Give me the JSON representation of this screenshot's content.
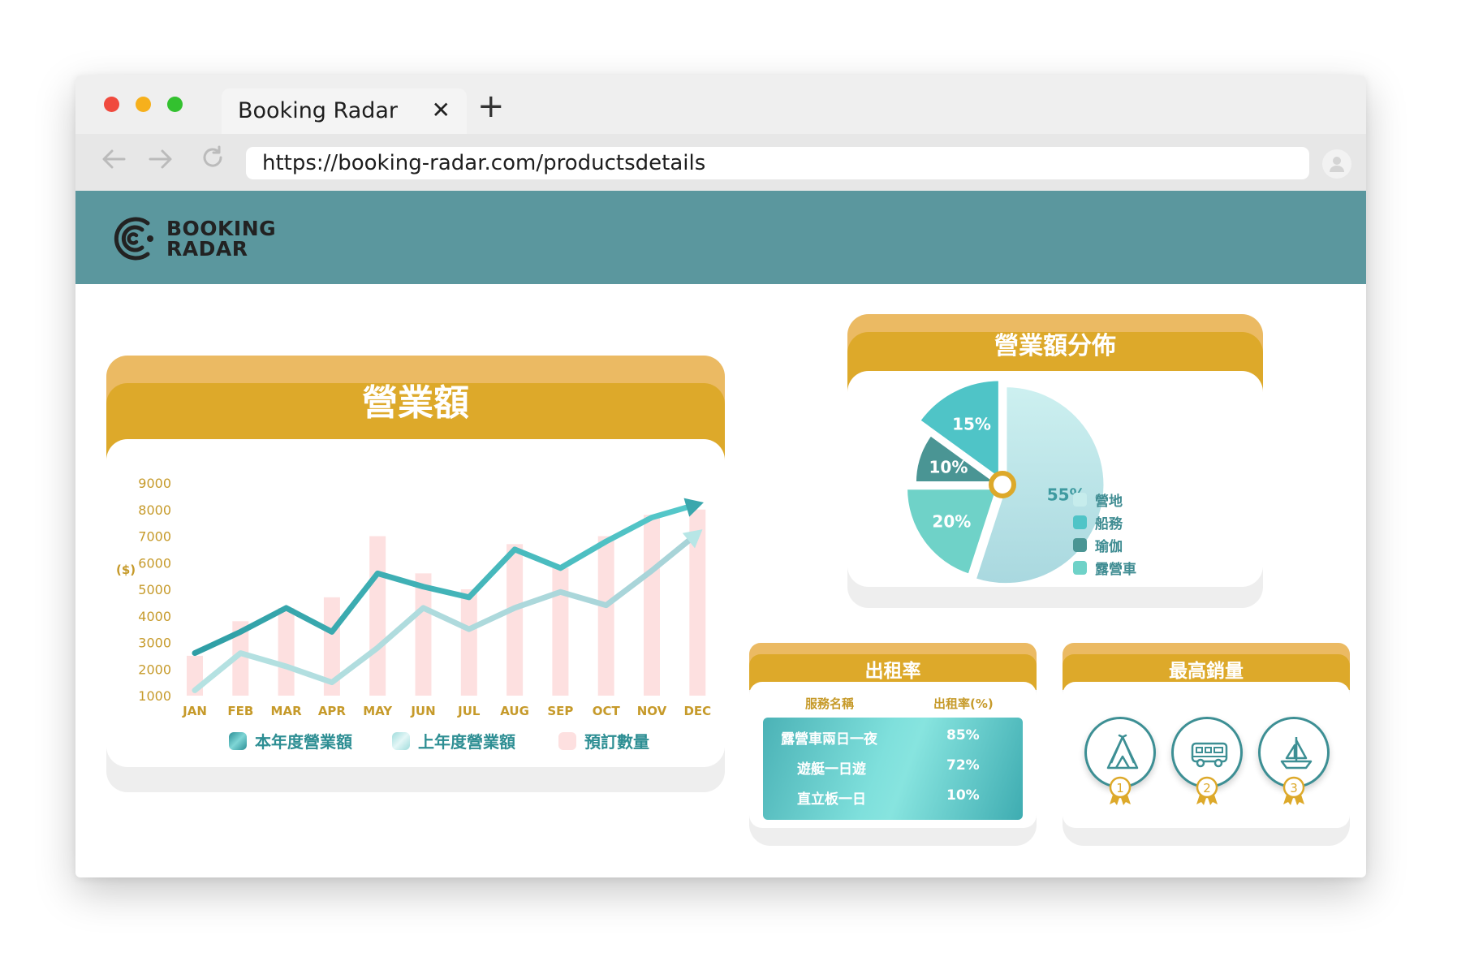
{
  "browser": {
    "tab_title": "Booking Radar",
    "url": "https://booking-radar.com/productsdetails"
  },
  "app": {
    "logo_line1": "BOOKING",
    "logo_line2": "RADAR"
  },
  "revenue_card": {
    "title": "營業額",
    "y_unit": "($)",
    "legend": [
      "本年度營業額",
      "上年度營業額",
      "預訂數量"
    ]
  },
  "distribution_card": {
    "title": "營業額分佈"
  },
  "rental_card": {
    "title": "出租率",
    "headers": [
      "服務名稱",
      "出租率(%)"
    ],
    "rows": [
      {
        "name": "露營車兩日一夜",
        "rate": "85%"
      },
      {
        "name": "遊艇一日遊",
        "rate": "72%"
      },
      {
        "name": "直立板一日",
        "rate": "10%"
      }
    ]
  },
  "top_sales_card": {
    "title": "最高銷量",
    "items": [
      {
        "icon": "tent-icon",
        "rank": "1"
      },
      {
        "icon": "campervan-icon",
        "rank": "2"
      },
      {
        "icon": "sailboat-icon",
        "rank": "3"
      }
    ]
  },
  "chart_data": [
    {
      "type": "line",
      "title": "營業額",
      "ylabel": "($)",
      "categories": [
        "JAN",
        "FEB",
        "MAR",
        "APR",
        "MAY",
        "JUN",
        "JUL",
        "AUG",
        "SEP",
        "OCT",
        "NOV",
        "DEC"
      ],
      "yticks": [
        1000,
        2000,
        3000,
        4000,
        5000,
        6000,
        7000,
        8000,
        9000
      ],
      "ylim": [
        1000,
        9000
      ],
      "series": [
        {
          "name": "本年度營業額",
          "type": "line",
          "color": "#3aa7ad",
          "values": [
            2600,
            3400,
            4300,
            3400,
            5600,
            5100,
            4700,
            6500,
            5800,
            6800,
            7700,
            8200
          ]
        },
        {
          "name": "上年度營業額",
          "type": "line",
          "color": "#b7e6e6",
          "values": [
            1200,
            2600,
            2100,
            1500,
            2800,
            4300,
            3500,
            4300,
            4900,
            4400,
            5700,
            7100
          ]
        },
        {
          "name": "預訂數量",
          "type": "bar",
          "color": "#fde0e0",
          "values": [
            2500,
            3800,
            4300,
            4700,
            7000,
            5600,
            5000,
            6700,
            5800,
            7000,
            7800,
            8000
          ]
        }
      ]
    },
    {
      "type": "pie",
      "title": "營業額分佈",
      "slices": [
        {
          "label": "營地",
          "value": 55,
          "text": "55%",
          "color": "#bde9ea"
        },
        {
          "label": "露營車",
          "value": 20,
          "text": "20%",
          "color": "#6fd2c8"
        },
        {
          "label": "瑜伽",
          "value": 10,
          "text": "10%",
          "color": "#4a9594"
        },
        {
          "label": "船務",
          "value": 15,
          "text": "15%",
          "color": "#4fc4c7"
        }
      ],
      "legend": [
        "營地",
        "船務",
        "瑜伽",
        "露營車"
      ],
      "legend_colors": [
        "#c6ecec",
        "#4fc4c7",
        "#4a9594",
        "#6fd2c8"
      ]
    }
  ]
}
